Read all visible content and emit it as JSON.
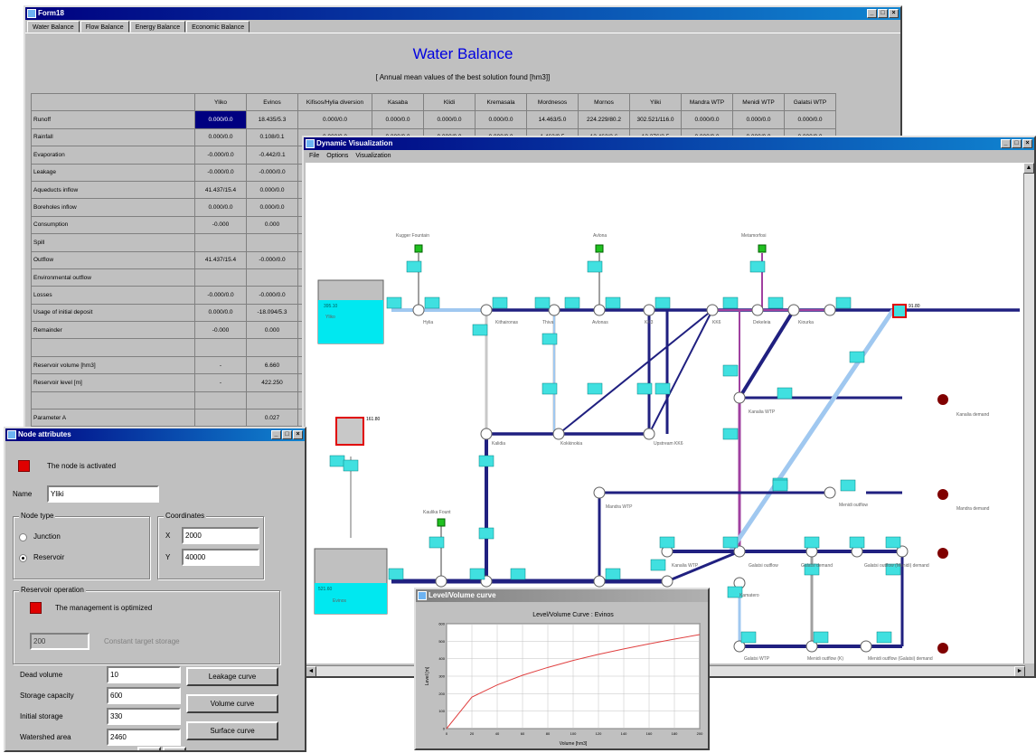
{
  "water_balance": {
    "window_title": "Form18",
    "tabs": [
      "Water Balance",
      "Flow Balance",
      "Energy Balance",
      "Economic Balance"
    ],
    "title": "Water Balance",
    "subtitle": "[ Annual mean values of the best solution found  [hm3]]",
    "columns": [
      "",
      "Yliko",
      "Evinos",
      "Kifisos/Hylia diversion",
      "Kasaba",
      "Klidi",
      "Kremasala",
      "Mordnesos",
      "Mornos",
      "Yliki",
      "Mandra WTP",
      "Menidi WTP",
      "Galatsi WTP"
    ],
    "rows": [
      {
        "label": "Runoff",
        "values": [
          "0.000/0.0",
          "18.435/5.3",
          "0.000/0.0",
          "0.000/0.0",
          "0.000/0.0",
          "0.000/0.0",
          "14.463/5.0",
          "224.229/80.2",
          "302.521/116.0",
          "0.000/0.0",
          "0.000/0.0",
          "0.000/0.0"
        ]
      },
      {
        "label": "Rainfall",
        "values": [
          "0.000/0.0",
          "0.108/0.1",
          "0.000/0.0",
          "0.000/0.0",
          "0.000/0.0",
          "0.000/0.0",
          "1.463/0.5",
          "12.462/3.6",
          "12.376/3.5",
          "0.000/0.0",
          "0.000/0.0",
          "0.000/0.0"
        ]
      },
      {
        "label": "Evaporation",
        "values": [
          "-0.000/0.0",
          "-0.442/0.1",
          "",
          "",
          "",
          "",
          "",
          "",
          "",
          "",
          "",
          ""
        ]
      },
      {
        "label": "Leakage",
        "values": [
          "-0.000/0.0",
          "-0.000/0.0",
          "",
          "",
          "",
          "",
          "",
          "",
          "",
          "",
          "",
          ""
        ]
      },
      {
        "label": "Aqueducts inflow",
        "values": [
          "41.437/15.4",
          "0.000/0.0",
          "",
          "",
          "",
          "",
          "",
          "",
          "",
          "",
          "",
          ""
        ]
      },
      {
        "label": "Boreholes inflow",
        "values": [
          "0.000/0.0",
          "0.000/0.0",
          "",
          "",
          "",
          "",
          "",
          "",
          "",
          "",
          "",
          ""
        ]
      },
      {
        "label": "Consumption",
        "values": [
          "-0.000",
          "0.000",
          "",
          "",
          "",
          "",
          "",
          "",
          "",
          "",
          "",
          ""
        ]
      },
      {
        "label": "Spill",
        "values": [
          "",
          "",
          "",
          "",
          "",
          "",
          "",
          "",
          "",
          "",
          "",
          ""
        ]
      },
      {
        "label": "Outflow",
        "values": [
          "41.437/15.4",
          "-0.000/0.0",
          "",
          "",
          "",
          "",
          "",
          "",
          "",
          "",
          "",
          ""
        ]
      },
      {
        "label": "Environmental outflow",
        "values": [
          "",
          "",
          "",
          "",
          "",
          "",
          "",
          "",
          "",
          "",
          "",
          ""
        ]
      },
      {
        "label": "Losses",
        "values": [
          "-0.000/0.0",
          "-0.000/0.0",
          "",
          "",
          "",
          "",
          "",
          "",
          "",
          "",
          "",
          ""
        ]
      },
      {
        "label": "Usage of initial deposit",
        "values": [
          "0.000/0.0",
          "-18.094/5.3",
          "",
          "",
          "",
          "",
          "",
          "",
          "",
          "",
          "",
          ""
        ]
      },
      {
        "label": "Remainder",
        "values": [
          "-0.000",
          "0.000",
          "",
          "",
          "",
          "",
          "",
          "",
          "",
          "",
          "",
          ""
        ]
      },
      {
        "label": "",
        "values": [
          "",
          "",
          "",
          "",
          "",
          "",
          "",
          "",
          "",
          "",
          "",
          ""
        ]
      },
      {
        "label": "Reservoir volume [hm3]",
        "values": [
          "-",
          "6.660",
          "",
          "",
          "",
          "",
          "",
          "",
          "",
          "",
          "",
          ""
        ]
      },
      {
        "label": "Reservoir level [m]",
        "values": [
          "-",
          "422.250",
          "",
          "",
          "",
          "",
          "",
          "",
          "",
          "",
          "",
          ""
        ]
      },
      {
        "label": "",
        "values": [
          "",
          "",
          "",
          "",
          "",
          "",
          "",
          "",
          "",
          "",
          "",
          ""
        ]
      },
      {
        "label": "Parameter A",
        "values": [
          "",
          "0.027",
          "",
          "",
          "",
          "",
          "",
          "",
          "",
          "",
          "",
          ""
        ]
      }
    ]
  },
  "dynamic_vis": {
    "window_title": "Dynamic Visualization",
    "menu": [
      "File",
      "Options",
      "Visualization"
    ],
    "reservoir_top_value": "395.10",
    "reservoir_bottom_value": "521.60",
    "reservoir_mid_label": "161.80",
    "reservoir_right_label": "91.80",
    "node_labels": {
      "kugger": "Kugger Fountain",
      "avlona": "Avlona",
      "metamorfosi": "Metamorfosi",
      "hylia": "Hylia",
      "kithaironas": "Kithaironas",
      "thiva": "Thiva",
      "avlonas": "Avlonas",
      "kk3": "KK3",
      "kk6": "KK6",
      "dekeleia": "Dekeleia",
      "kiourka": "Kiourka",
      "kallidia": "Kalidia",
      "kokkinokia": "Kokkinokia",
      "upstream_kk6": "Upstream KK6",
      "kanalia_wtp": "Kanalia WTP",
      "kanalia_demand": "Kanalia demand",
      "mandra_wtp": "Mandra WTP",
      "mandra_demand": "Mandra demand",
      "menidi_outflow": "Menidi outflow",
      "kaulika_fountain": "Kaulika Fount",
      "distomo": "Distomo",
      "kithairon_diversion": "Kithaironas diversion",
      "mandra": "Mandra",
      "menidi": "Menidi",
      "kanalia_wtp2": "Kanalia WTP",
      "galatsi_outflow": "Galatsi outflow",
      "galatsi_demand": "Galatsi demand",
      "galatsi_menidi_demand": "Galatsi outflow (Menidi) demand",
      "kamatero": "Kamatero",
      "galatsi_wtp": "Galatsi WTP",
      "menidi_outflow_k": "Menidi outflow (K)",
      "menidi_demand": "Menidi outflow (Galatsi) demand",
      "yliko": "Yliko",
      "evinos": "Evinos"
    }
  },
  "level_volume": {
    "window_title": "Level/Volume curve",
    "chart_data": {
      "type": "line",
      "title": "Level/Volume Curve : Evinos",
      "xlabel": "Volume [hm3]",
      "ylabel": "Level [m]",
      "x": [
        0,
        20,
        40,
        60,
        80,
        100,
        120,
        140,
        160,
        180,
        200
      ],
      "series": [
        {
          "values": [
            0,
            180,
            250,
            305,
            350,
            390,
            425,
            456,
            485,
            512,
            538
          ]
        }
      ],
      "xlim": [
        0,
        200
      ],
      "ylim": [
        0,
        600
      ],
      "grid": true,
      "line_color": "#e04040"
    }
  },
  "node_attributes": {
    "window_title": "Node attributes",
    "activated_text": "The node is activated",
    "name_label": "Name",
    "name_value": "Yliki",
    "node_type_label": "Node type",
    "junction_label": "Junction",
    "reservoir_label": "Reservoir",
    "coordinates_label": "Coordinates",
    "x_label": "X",
    "x_value": "2000",
    "y_label": "Y",
    "y_value": "40000",
    "reservoir_operation_label": "Reservoir operation",
    "management_text": "The management is optimized",
    "target_value": "200",
    "target_label": "Constant target storage",
    "dead_volume_label": "Dead volume",
    "dead_volume_value": "10",
    "storage_capacity_label": "Storage capacity",
    "storage_capacity_value": "600",
    "initial_storage_label": "Initial storage",
    "initial_storage_value": "330",
    "watershed_area_label": "Watershed area",
    "watershed_area_value": "2460",
    "leakage_curve_button": "Leakage curve",
    "volume_curve_button": "Volume curve",
    "surface_curve_button": "Surface curve",
    "prev_button": "◄",
    "next_button": "►"
  },
  "colors": {
    "title_active": "#000080",
    "link_dark": "#202080",
    "link_light": "#a0c8f0",
    "link_purple": "#a040a0",
    "label_cyan": "#40e0e0",
    "reservoir_water": "#00e8f0",
    "demand_node": "#800000",
    "source_node": "#20c020"
  }
}
